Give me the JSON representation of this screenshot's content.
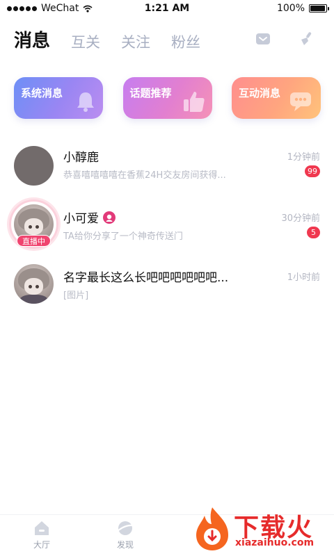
{
  "status_bar": {
    "carrier": "WeChat",
    "time": "1:21 AM",
    "battery_text": "100%",
    "battery_level": 1.0
  },
  "tabs": [
    {
      "label": "消息",
      "active": true
    },
    {
      "label": "互关",
      "active": false
    },
    {
      "label": "关注",
      "active": false
    },
    {
      "label": "粉丝",
      "active": false
    }
  ],
  "header_icons": [
    "mail-icon",
    "broom-icon"
  ],
  "cards": [
    {
      "label": "系统消息",
      "icon": "bell-icon"
    },
    {
      "label": "话题推荐",
      "icon": "thumbs-up-icon"
    },
    {
      "label": "互动消息",
      "icon": "chat-bubble-icon"
    }
  ],
  "conversations": [
    {
      "name": "小醇鹿",
      "time": "1分钟前",
      "preview": "恭喜嘻嘻嘻嘻在香蕉24H交友房间获得...",
      "unread": "99",
      "live": false
    },
    {
      "name": "小可爱",
      "time": "30分钟前",
      "preview": "TA给你分享了一个神奇传送门",
      "unread": "5",
      "live": true,
      "live_label": "直播中"
    },
    {
      "name": "名字最长这么长吧吧吧吧吧吧...",
      "time": "1小时前",
      "preview": "[图片]",
      "unread": "",
      "live": false
    }
  ],
  "bottom_nav": [
    {
      "label": "大厅",
      "icon": "home-icon"
    },
    {
      "label": "发现",
      "icon": "planet-icon"
    }
  ],
  "watermark": {
    "title": "下载火",
    "subtitle": "xiazaihuo.com"
  },
  "colors": {
    "accent_red": "#f0384f",
    "live_pink": "#f0446f",
    "tab_inactive": "#a8afc2"
  }
}
